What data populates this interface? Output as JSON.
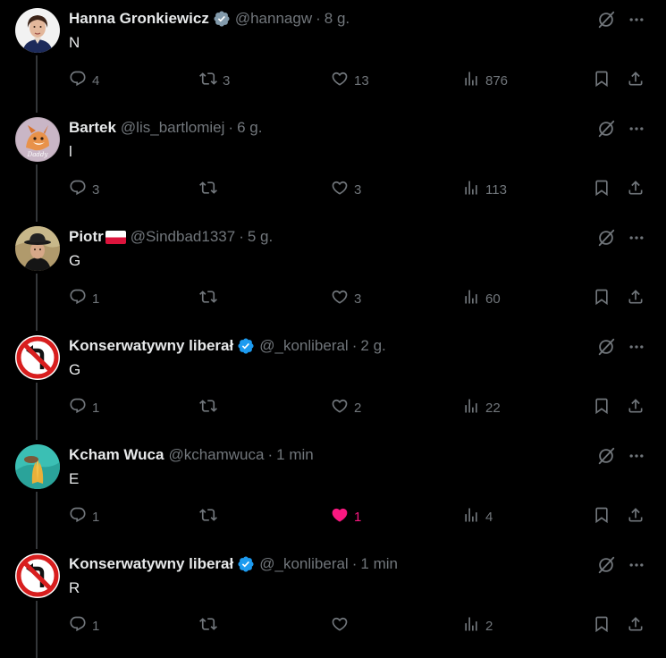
{
  "colors": {
    "background": "#000000",
    "text_primary": "#e7e9ea",
    "text_secondary": "#71767b",
    "verified_blue": "#1d9bf0",
    "like_pink": "#f91880",
    "thread_line": "#333639"
  },
  "tweets": [
    {
      "display_name": "Hanna Gronkiewicz",
      "verified": "gray",
      "handle": "@hannagw",
      "time": "8 g.",
      "text": "N",
      "reply_count": "4",
      "retweet_count": "3",
      "like_count": "13",
      "liked": false,
      "view_count": "876",
      "avatar": "woman-portrait"
    },
    {
      "display_name": "Bartek",
      "verified": "none",
      "handle": "@lis_bartlomiej",
      "time": "6 g.",
      "text": "l",
      "reply_count": "3",
      "retweet_count": "",
      "like_count": "3",
      "liked": false,
      "view_count": "113",
      "avatar": "fox-daddy"
    },
    {
      "display_name": "Piotr",
      "verified": "none",
      "flag": "poland-flag",
      "handle": "@Sindbad1337",
      "time": "5 g.",
      "text": "G",
      "reply_count": "1",
      "retweet_count": "",
      "like_count": "3",
      "liked": false,
      "view_count": "60",
      "avatar": "man-hat"
    },
    {
      "display_name": "Konserwatywny liberał",
      "verified": "blue",
      "handle": "@_konliberal",
      "time": "2 g.",
      "text": "G",
      "reply_count": "1",
      "retweet_count": "",
      "like_count": "2",
      "liked": false,
      "view_count": "22",
      "avatar": "no-left-turn-sign"
    },
    {
      "display_name": "Kcham Wuca",
      "verified": "none",
      "handle": "@kchamwuca",
      "time": "1 min",
      "text": "E",
      "reply_count": "1",
      "retweet_count": "",
      "like_count": "1",
      "liked": true,
      "view_count": "4",
      "avatar": "praying-hands"
    },
    {
      "display_name": "Konserwatywny liberał",
      "verified": "blue",
      "handle": "@_konliberal",
      "time": "1 min",
      "text": "R",
      "reply_count": "1",
      "retweet_count": "",
      "like_count": "",
      "liked": false,
      "view_count": "2",
      "avatar": "no-left-turn-sign"
    }
  ]
}
